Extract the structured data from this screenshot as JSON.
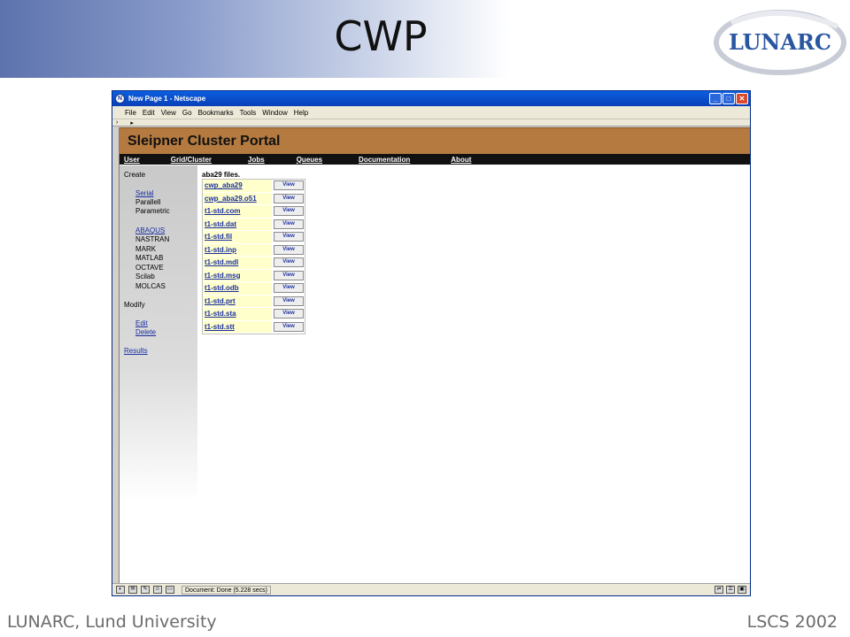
{
  "slide": {
    "title": "CWP",
    "logo_text": "LUNARC",
    "footer_left": "LUNARC, Lund University",
    "footer_right": "LSCS 2002"
  },
  "window": {
    "title": "New Page 1 - Netscape",
    "controls": [
      "minimize-icon",
      "maximize-icon",
      "close-icon"
    ]
  },
  "menubar": [
    "File",
    "Edit",
    "View",
    "Go",
    "Bookmarks",
    "Tools",
    "Window",
    "Help"
  ],
  "portal": {
    "title": "Sleipner Cluster Portal",
    "nav": [
      "User",
      "Grid/Cluster",
      "Jobs",
      "Queues",
      "Documentation",
      "About"
    ]
  },
  "sidebar": {
    "create_label": "Create",
    "serial": "Serial",
    "parallel": "Parallell",
    "parametric": "Parametric",
    "abaqus": "ABAQUS",
    "apps": [
      "NASTRAN",
      "MARK",
      "MATLAB",
      "OCTAVE",
      "Scilab",
      "MOLCAS"
    ],
    "modify_label": "Modify",
    "edit": "Edit",
    "delete": "Delete",
    "results": "Results"
  },
  "files": {
    "title": "aba29 files.",
    "view_label": "View",
    "names": [
      "cwp_aba29",
      "cwp_aba29.o51",
      "t1-std.com",
      "t1-std.dat",
      "t1-std.fil",
      "t1-std.inp",
      "t1-std.mdl",
      "t1-std.msg",
      "t1-std.odb",
      "t1-std.prt",
      "t1-std.sta",
      "t1-std.stt"
    ]
  },
  "status": {
    "text": "Document: Done (5.228 secs)"
  },
  "colors": {
    "portal_header": "#b47a40",
    "portal_nav": "#111111",
    "file_cell": "#ffffcc",
    "link": "#1a2fa0",
    "titlebar": "#0a5fe0"
  }
}
